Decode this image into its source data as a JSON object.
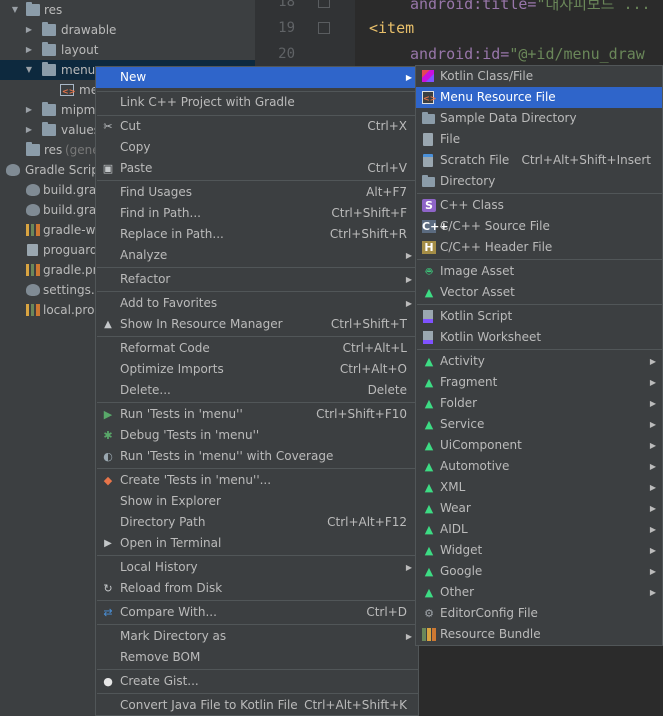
{
  "tree": {
    "items": [
      {
        "label": "res",
        "icon": "folder-icon"
      },
      {
        "label": "drawable",
        "icon": "folder-icon"
      },
      {
        "label": "layout",
        "icon": "folder-icon"
      },
      {
        "label": "menu",
        "icon": "folder-icon"
      },
      {
        "label": "me",
        "icon": "xml-file-icon"
      },
      {
        "label": "mipma",
        "icon": "folder-icon"
      },
      {
        "label": "values",
        "icon": "folder-icon"
      },
      {
        "label": "res",
        "suffix": "(gener",
        "icon": "folder-icon"
      },
      {
        "label": "Gradle Script",
        "icon": "gradle-icon"
      },
      {
        "label": "build.grac",
        "icon": "gradle-icon"
      },
      {
        "label": "build.grac",
        "icon": "gradle-icon"
      },
      {
        "label": "gradle-wra",
        "icon": "bars-icon"
      },
      {
        "label": "proguard-",
        "icon": "file-icon"
      },
      {
        "label": "gradle.pro",
        "icon": "bars-icon"
      },
      {
        "label": "settings.g",
        "icon": "gradle-icon"
      },
      {
        "label": "local.prop",
        "icon": "bars-icon"
      }
    ]
  },
  "editor": {
    "lines": [
      {
        "num": "18",
        "attr": "android:title=",
        "str": "\"대사피보드 ..."
      },
      {
        "num": "19",
        "tag": "<item"
      },
      {
        "num": "20",
        "attr": "android:id=",
        "str": "\"@+id/menu_draw"
      }
    ]
  },
  "context_menu": {
    "items": [
      {
        "label": "New",
        "submenu": true,
        "highlighted": true
      },
      {
        "label": "Link C++ Project with Gradle"
      },
      {
        "label": "Cut",
        "shortcut": "Ctrl+X",
        "icon": "cut-icon"
      },
      {
        "label": "Copy"
      },
      {
        "label": "Paste",
        "shortcut": "Ctrl+V",
        "icon": "paste-icon"
      },
      {
        "label": "Find Usages",
        "shortcut": "Alt+F7"
      },
      {
        "label": "Find in Path...",
        "shortcut": "Ctrl+Shift+F"
      },
      {
        "label": "Replace in Path...",
        "shortcut": "Ctrl+Shift+R"
      },
      {
        "label": "Analyze",
        "submenu": true
      },
      {
        "label": "Refactor",
        "submenu": true
      },
      {
        "label": "Add to Favorites",
        "submenu": true
      },
      {
        "label": "Show In Resource Manager",
        "shortcut": "Ctrl+Shift+T",
        "icon": "resource-manager-icon"
      },
      {
        "label": "Reformat Code",
        "shortcut": "Ctrl+Alt+L"
      },
      {
        "label": "Optimize Imports",
        "shortcut": "Ctrl+Alt+O"
      },
      {
        "label": "Delete...",
        "shortcut": "Delete"
      },
      {
        "label": "Run 'Tests in 'menu''",
        "shortcut": "Ctrl+Shift+F10",
        "icon": "run-icon"
      },
      {
        "label": "Debug 'Tests in 'menu''",
        "icon": "debug-icon"
      },
      {
        "label": "Run 'Tests in 'menu'' with Coverage",
        "icon": "coverage-icon"
      },
      {
        "label": "Create 'Tests in 'menu''...",
        "icon": "create-test-icon"
      },
      {
        "label": "Show in Explorer"
      },
      {
        "label": "Directory Path",
        "shortcut": "Ctrl+Alt+F12"
      },
      {
        "label": "Open in Terminal",
        "icon": "terminal-icon"
      },
      {
        "label": "Local History",
        "submenu": true
      },
      {
        "label": "Reload from Disk",
        "icon": "reload-icon"
      },
      {
        "label": "Compare With...",
        "shortcut": "Ctrl+D",
        "icon": "compare-icon"
      },
      {
        "label": "Mark Directory as",
        "submenu": true
      },
      {
        "label": "Remove BOM"
      },
      {
        "label": "Create Gist...",
        "icon": "github-icon"
      },
      {
        "label": "Convert Java File to Kotlin File",
        "shortcut": "Ctrl+Alt+Shift+K"
      }
    ]
  },
  "new_submenu": {
    "items": [
      {
        "label": "Kotlin Class/File",
        "icon": "kotlin-icon"
      },
      {
        "label": "Menu Resource File",
        "icon": "xml-file-icon",
        "highlighted": true
      },
      {
        "label": "Sample Data Directory",
        "icon": "folder-icon"
      },
      {
        "label": "File",
        "icon": "file-icon"
      },
      {
        "label": "Scratch File",
        "shortcut": "Ctrl+Alt+Shift+Insert",
        "icon": "scratch-file-icon"
      },
      {
        "label": "Directory",
        "icon": "folder-icon"
      },
      {
        "label": "C++ Class",
        "icon": "cpp-class-icon"
      },
      {
        "label": "C/C++ Source File",
        "icon": "cpp-source-icon"
      },
      {
        "label": "C/C++ Header File",
        "icon": "cpp-header-icon"
      },
      {
        "label": "Image Asset",
        "icon": "android-icon"
      },
      {
        "label": "Vector Asset",
        "icon": "android-icon"
      },
      {
        "label": "Kotlin Script",
        "icon": "kotlin-file-icon"
      },
      {
        "label": "Kotlin Worksheet",
        "icon": "kotlin-file-icon"
      },
      {
        "label": "Activity",
        "icon": "android-icon",
        "submenu": true
      },
      {
        "label": "Fragment",
        "icon": "android-icon",
        "submenu": true
      },
      {
        "label": "Folder",
        "icon": "android-icon",
        "submenu": true
      },
      {
        "label": "Service",
        "icon": "android-icon",
        "submenu": true
      },
      {
        "label": "UiComponent",
        "icon": "android-icon",
        "submenu": true
      },
      {
        "label": "Automotive",
        "icon": "android-icon",
        "submenu": true
      },
      {
        "label": "XML",
        "icon": "android-icon",
        "submenu": true
      },
      {
        "label": "Wear",
        "icon": "android-icon",
        "submenu": true
      },
      {
        "label": "AIDL",
        "icon": "android-icon",
        "submenu": true
      },
      {
        "label": "Widget",
        "icon": "android-icon",
        "submenu": true
      },
      {
        "label": "Google",
        "icon": "android-icon",
        "submenu": true
      },
      {
        "label": "Other",
        "icon": "android-icon",
        "submenu": true
      },
      {
        "label": "EditorConfig File",
        "icon": "gear-icon"
      },
      {
        "label": "Resource Bundle",
        "icon": "resource-bundle-icon"
      }
    ]
  },
  "colors": {
    "menu_bg": "#3c3f41",
    "highlight": "#2f65ca",
    "android_green": "#3ddc84",
    "editor_bg": "#2b2b2b"
  }
}
